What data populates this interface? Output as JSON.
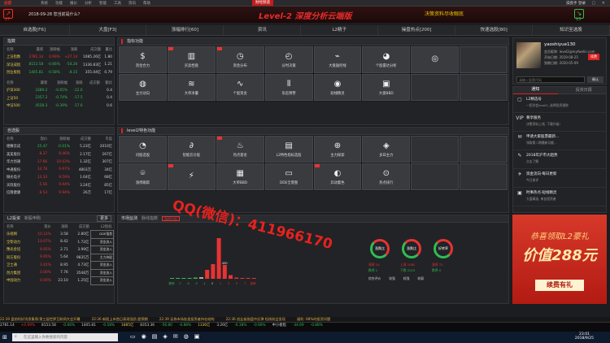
{
  "top": {
    "logo": "益盟",
    "menu": [
      "系统",
      "功能",
      "报价",
      "分析",
      "智能",
      "工具",
      "资讯",
      "帮助"
    ],
    "badge": "财经频道",
    "right": "操盘手 登录",
    "win_controls": "— ▢ ✕"
  },
  "banner": {
    "date": "2018-09-28 您当前是什么？",
    "title": "Level-2  深度分析云端版",
    "slogan": "决策资料尽收眼底",
    "left_num": "27",
    "right_num": "15"
  },
  "tabs": [
    "自选股[F6]",
    "大盘[F3]",
    "涨幅排行[60]",
    "资讯",
    "L2精子",
    "操盘热点[200]",
    "快速选股[80]",
    "知识至选股"
  ],
  "index_panel": {
    "title": "指数",
    "headers": [
      "名称",
      "最新",
      "涨跌幅",
      "涨跌",
      "成交额",
      "量比"
    ],
    "rows": [
      [
        "上证指数",
        "2781.14",
        "0.99%",
        "+27.14",
        "1085.26亿",
        "1.80"
      ],
      [
        "深证成指",
        "8153.58",
        "-0.66%",
        "-54.26",
        "1336.83亿",
        "1.21"
      ],
      [
        "创业板指",
        "1405.81",
        "-0.58%",
        "-8.15",
        "355.04亿",
        "0.79"
      ]
    ],
    "headers2": [
      "名称",
      "最新",
      "涨跌幅",
      "涨跌",
      "成交额",
      "额比"
    ],
    "rows2": [
      [
        "沪深300",
        "3389.2",
        "-0.65%",
        "-22.6",
        "",
        "0.4"
      ],
      [
        "上证50",
        "2357.2",
        "-0.74%",
        "-17.5",
        "",
        "0.4"
      ],
      [
        "中证500",
        "4558.3",
        "-0.39%",
        "-17.6",
        "",
        "0.6"
      ]
    ]
  },
  "watch_panel": {
    "title": "自选股",
    "headers": [
      "名称",
      "现价",
      "涨跌幅",
      "成交额",
      "市盈"
    ],
    "rows": [
      [
        "德赛云成",
        "25.47",
        "-0.01%",
        "5.23亿",
        "2010亿"
      ],
      [
        "美美股份",
        "8.37",
        "8.46%",
        "2.17亿",
        "267亿"
      ],
      [
        "华力创通",
        "17.66",
        "10.03%",
        "1.32亿",
        "307亿"
      ],
      [
        "中通股份",
        "14.78",
        "9.97%",
        "4803万",
        "34亿"
      ],
      [
        "微光电子",
        "13.33",
        "9.59%",
        "1.64亿",
        "68亿"
      ],
      [
        "天际股份",
        "5.56",
        "9.94%",
        "3.24亿",
        "85亿"
      ],
      [
        "信隆健康",
        "8.53",
        "9.94%",
        "26万",
        "17亿"
      ]
    ]
  },
  "l2_panel": {
    "title": "L2投资",
    "tab2": "新股申购",
    "select": "更多",
    "headers": [
      "名称",
      "现价",
      "涨跌",
      "成交额",
      "L2指标"
    ],
    "rows": [
      [
        "乐视网",
        "10.12%",
        "3.58",
        "2.80亿",
        "DDE强势"
      ],
      [
        "全柴动力",
        "10.07%",
        "8.42",
        "1.72亿",
        "资金流入"
      ],
      [
        "豫光金铅",
        "9.95%",
        "2.71",
        "3.99亿",
        "资金流入"
      ],
      [
        "同方股份",
        "9.95%",
        "5.64",
        "9835万",
        "主力持股"
      ],
      [
        "卫士通",
        "3.42%",
        "8.95",
        "4.73亿",
        "资金流入"
      ],
      [
        "创力集团",
        "0.00%",
        "7.76",
        "3548万",
        "资金流入"
      ],
      [
        "中国动力",
        "0.00%",
        "23.10",
        "1.25亿",
        "资金流入"
      ]
    ]
  },
  "quant_section": {
    "title": "指标功能",
    "tiles": [
      {
        "glyph": "$",
        "label": "资金合力",
        "tag": false
      },
      {
        "glyph": "▥",
        "label": "买卖档盘",
        "tag": true
      },
      {
        "glyph": "◷",
        "label": "资金分布",
        "tag": true
      },
      {
        "glyph": "◴",
        "label": "分时决策",
        "tag": false
      },
      {
        "glyph": "⌁",
        "label": "大盘操控线",
        "tag": false
      },
      {
        "glyph": "◕",
        "label": "个股雷达分析",
        "tag": false
      },
      {
        "glyph": "◎",
        "label": "",
        "tag": false
      },
      {
        "glyph": "",
        "label": "",
        "tag": false
      },
      {
        "glyph": "◍",
        "label": "主力动向",
        "tag": false
      },
      {
        "glyph": "≋",
        "label": "大单净量",
        "tag": false
      },
      {
        "glyph": "∿",
        "label": "个股资金",
        "tag": false
      },
      {
        "glyph": "⫴",
        "label": "形态预警",
        "tag": false
      },
      {
        "glyph": "◉",
        "label": "短线精灵",
        "tag": false
      },
      {
        "glyph": "▣",
        "label": "大盘BBD",
        "tag": false
      },
      {
        "glyph": "",
        "label": "",
        "tag": false
      },
      {
        "glyph": "",
        "label": "",
        "tag": false
      }
    ]
  },
  "l2_section": {
    "title": "level2特色功能",
    "tiles": [
      {
        "glyph": "◔",
        "label": "问股选股",
        "tag": false
      },
      {
        "glyph": "∂",
        "label": "智能云诊股",
        "tag": false
      },
      {
        "glyph": "♨",
        "label": "热点基金",
        "tag": true
      },
      {
        "glyph": "▤",
        "label": "L2特色指标选股",
        "tag": false
      },
      {
        "glyph": "⊕",
        "label": "主力探索",
        "tag": false
      },
      {
        "glyph": "◈",
        "label": "多日主力",
        "tag": false
      },
      {
        "glyph": "",
        "label": "",
        "tag": false
      },
      {
        "glyph": "",
        "label": "",
        "tag": false
      },
      {
        "glyph": "⌾",
        "label": "涨停跟踪",
        "tag": false
      },
      {
        "glyph": "⚡",
        "label": "",
        "tag": true
      },
      {
        "glyph": "▦",
        "label": "大单BBD",
        "tag": false
      },
      {
        "glyph": "▭",
        "label": "DDE全景图",
        "tag": false
      },
      {
        "glyph": "◐",
        "label": "异动着色",
        "tag": true
      },
      {
        "glyph": "⊙",
        "label": "热点排行",
        "tag": false
      },
      {
        "glyph": "",
        "label": "",
        "tag": false
      },
      {
        "glyph": "",
        "label": "",
        "tag": false
      }
    ]
  },
  "market_panel": {
    "title": "市场监测",
    "tab2": "脉线指数",
    "button": "涨停分析",
    "bars": [
      1,
      1,
      1,
      2,
      3,
      4,
      22,
      36,
      100,
      34,
      9,
      3,
      1,
      1,
      1
    ],
    "bar_values": [
      "",
      "",
      "",
      "",
      "",
      "",
      "",
      "",
      "",
      "430",
      "",
      "",
      "",
      "",
      ""
    ],
    "bar_ticks": [
      "跌停",
      "-7",
      "-5",
      "-3",
      "-1",
      "0",
      "1",
      "3",
      "5",
      "7",
      "涨停"
    ],
    "rings": [
      {
        "label": "涨跌比",
        "legend1": "涨停 24",
        "legend2": "跌停 1"
      },
      {
        "label": "涨跌比",
        "legend1": "上涨 1082",
        "legend2": "下跌 2215"
      },
      {
        "label": "好转率",
        "legend1": "涨停 72",
        "legend2": "跌停 0"
      }
    ],
    "ring_footer": [
      "综合评价",
      "较强",
      "较强",
      "较弱"
    ]
  },
  "user": {
    "name": "yaoshiyue130",
    "line1": "会员昵称: level2@myfwelin.com",
    "line2": "开始日期: 2019-08-25",
    "line3": "到期日期: 2020-05-09",
    "renew": "续费",
    "search_placeholder": "请输入股票代码",
    "search_button": "确认",
    "tab1": "通知",
    "tab2": "投资日报"
  },
  "notices": [
    {
      "icon": "▢",
      "text": "L2精选号",
      "sub": "一招学会level2, 选择投资理财"
    },
    {
      "icon": "VIP",
      "text": "尊享服务",
      "sub": "决策资料上线, 下载升级!"
    },
    {
      "icon": "✉",
      "text": "申请大家股票最新...",
      "sub": "领取第二期最新功能..."
    },
    {
      "icon": "✎",
      "text": "2018年沪市大趋势",
      "sub": "点击了解"
    },
    {
      "icon": "✈",
      "text": "资金流向·每日更新",
      "sub": "今日收评"
    },
    {
      "icon": "▣",
      "text": "时事热点·短线精灵",
      "sub": "大盘精选, 来自投资者"
    }
  ],
  "ad": {
    "line1": "恭喜领取L2豪礼",
    "line2": "价值288元",
    "button": "续费有礼"
  },
  "watermark": "QQ(微信)：411966170",
  "news": [
    "22:39 盘前利好消息集锦:第三届世界互联网大会开幕",
    "22:36 新股上市首日表现强劲 超预期",
    "22:39 证券市场各类投资者持仓结构",
    "22:36 创业板指盘中反弹 短线机会显现",
    "福利: 98%的投资问题"
  ],
  "status": [
    {
      "text": "2781.14",
      "cls": "w"
    },
    {
      "text": "+0.99%",
      "cls": "r"
    },
    {
      "text": "8153.58",
      "cls": "w"
    },
    {
      "text": "-0.66%",
      "cls": "g"
    },
    {
      "text": "1405.81",
      "cls": "w"
    },
    {
      "text": "-0.58%",
      "cls": "g"
    },
    {
      "text": "1885亿",
      "cls": "y"
    },
    {
      "text": "8353.36",
      "cls": "w"
    },
    {
      "text": "-56.80",
      "cls": "g"
    },
    {
      "text": "-0.88%",
      "cls": "g"
    },
    {
      "text": "1336亿",
      "cls": "y"
    },
    {
      "text": "3.26亿",
      "cls": "w"
    },
    {
      "text": "-0.38%",
      "cls": "g"
    },
    {
      "text": "-0.66%",
      "cls": "g"
    },
    {
      "text": "中小板指",
      "cls": "w"
    },
    {
      "text": "-34.69",
      "cls": "g"
    },
    {
      "text": "-0.88%",
      "cls": "g"
    }
  ],
  "taskbar": {
    "search_placeholder": "在这里输入你要搜索的内容",
    "time": "23:01",
    "date": "2018/9/25"
  }
}
